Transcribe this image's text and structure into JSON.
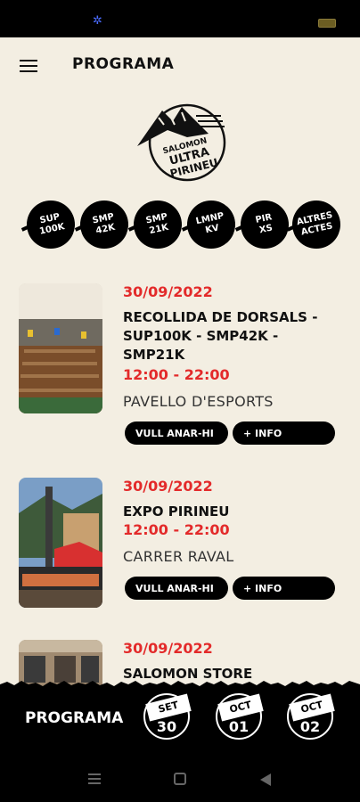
{
  "app": {
    "title": "PROGRAMA"
  },
  "logo": {
    "line1": "SALOMON",
    "line2": "ULTRA",
    "line3": "PIRINEU"
  },
  "categories": [
    {
      "label": "SUP\n100K"
    },
    {
      "label": "SMP\n42K"
    },
    {
      "label": "SMP\n21K"
    },
    {
      "label": "LMNP\nKV"
    },
    {
      "label": "PIR\nXS"
    },
    {
      "label": "ALTRES\nACTES"
    }
  ],
  "events": [
    {
      "date": "30/09/2022",
      "title": "RECOLLIDA DE DORSALS - SUP100K - SMP42K - SMP21K",
      "time": "12:00 - 22:00",
      "place": "PAVELLO D'ESPORTS",
      "go_label": "VULL ANAR-HI",
      "info_label": "+ INFO"
    },
    {
      "date": "30/09/2022",
      "title": "EXPO PIRINEU",
      "time": "12:00 - 22:00",
      "place": "CARRER RAVAL",
      "go_label": "VULL ANAR-HI",
      "info_label": "+ INFO"
    },
    {
      "date": "30/09/2022",
      "title": "SALOMON STORE"
    }
  ],
  "bottom": {
    "title": "PROGRAMA",
    "days": [
      {
        "month": "SET",
        "day": "30"
      },
      {
        "month": "OCT",
        "day": "01"
      },
      {
        "month": "OCT",
        "day": "02"
      }
    ]
  }
}
